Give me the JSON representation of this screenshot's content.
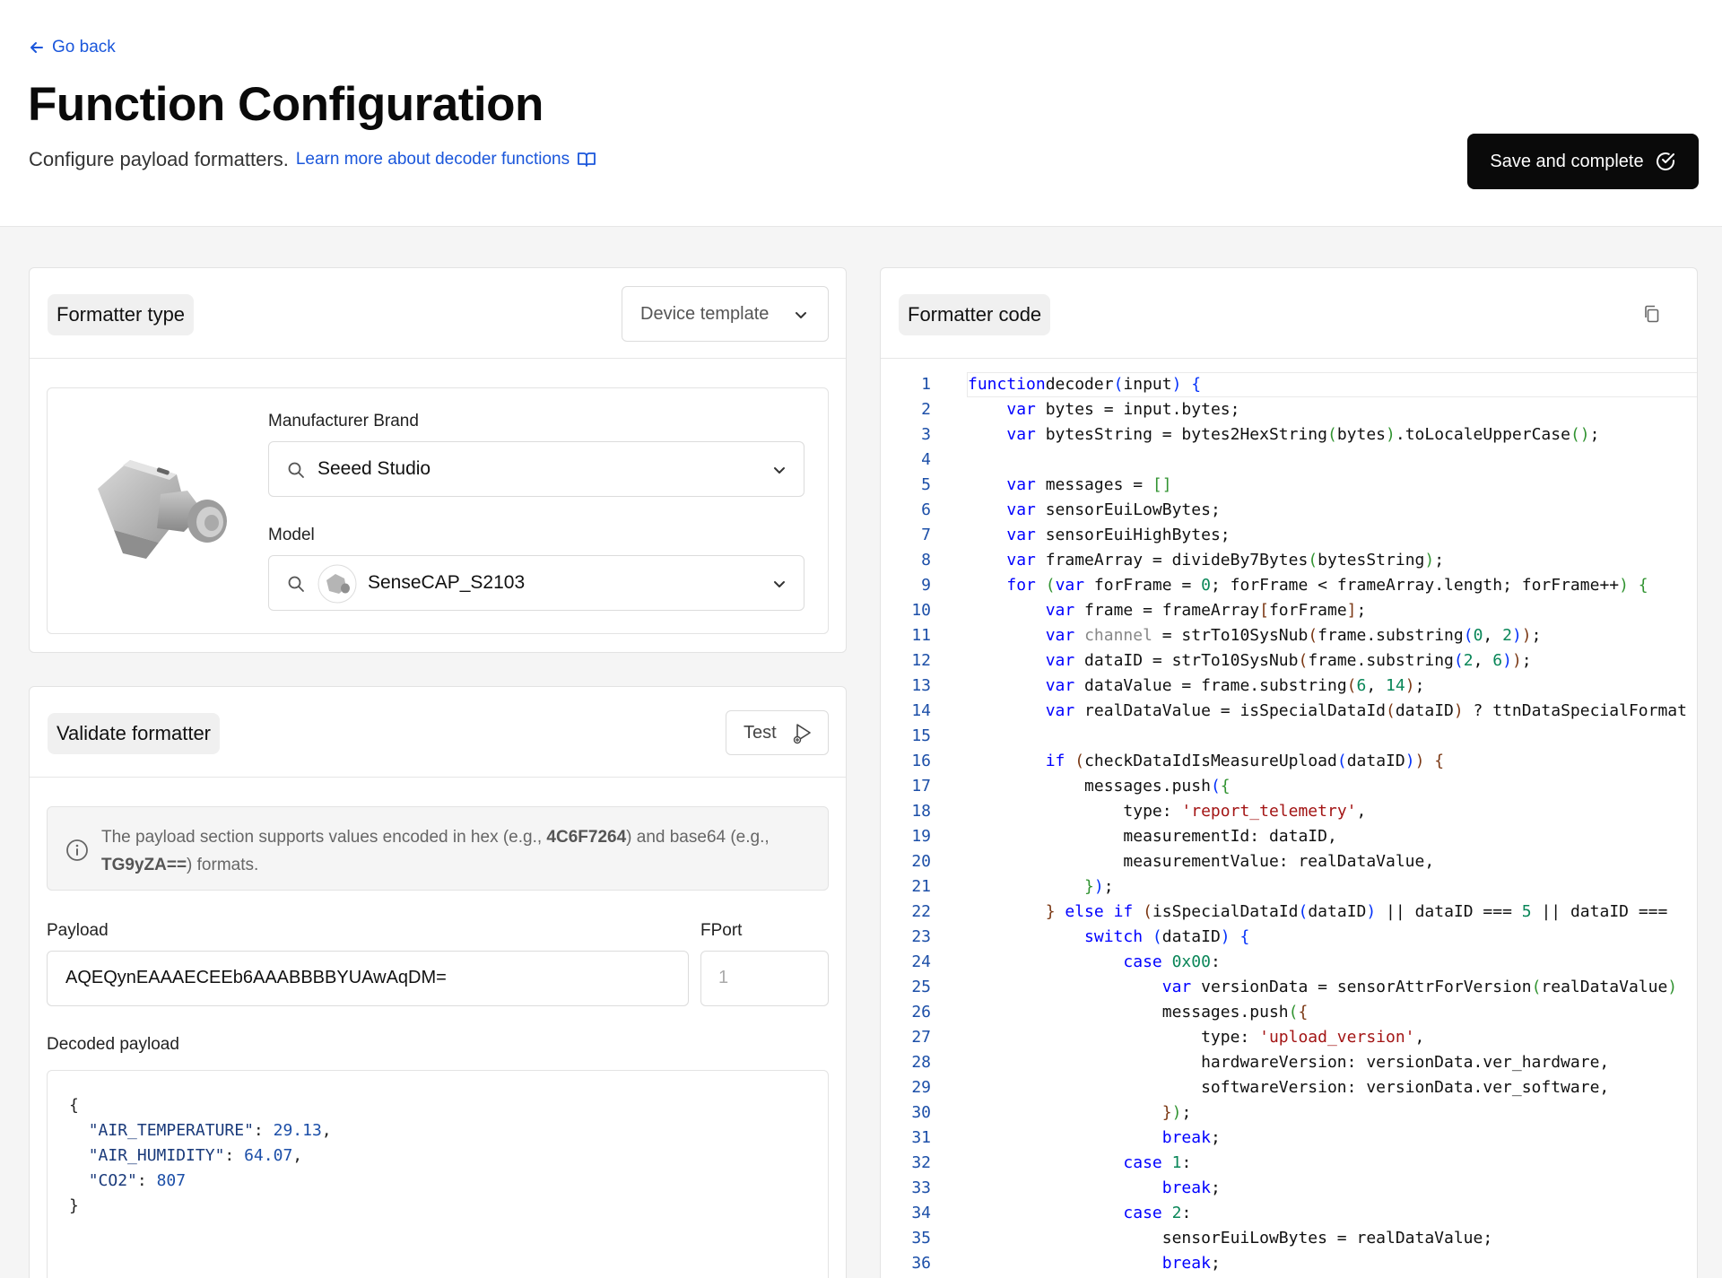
{
  "header": {
    "go_back": "Go back",
    "title": "Function Configuration",
    "subtitle": "Configure payload formatters.",
    "learn_more": "Learn more about decoder functions",
    "save_button": "Save and complete"
  },
  "formatter_type": {
    "heading": "Formatter type",
    "selected": "Device template",
    "manufacturer_label": "Manufacturer Brand",
    "manufacturer_value": "Seeed Studio",
    "model_label": "Model",
    "model_value": "SenseCAP_S2103"
  },
  "validate": {
    "heading": "Validate formatter",
    "test_button": "Test",
    "info": {
      "part1": "The payload section supports values encoded in hex (e.g., ",
      "hex_example": "4C6F7264",
      "part2": ") and base64 (e.g., ",
      "b64_example": "TG9yZA==",
      "part3": ") formats."
    },
    "payload_label": "Payload",
    "payload_value": "AQEQynEAAAECEEb6AAABBBBYUAwAqDM=",
    "fport_label": "FPort",
    "fport_placeholder": "1",
    "decoded_label": "Decoded payload",
    "decoded": {
      "open": "{",
      "close": "}",
      "entries": [
        {
          "key": "\"AIR_TEMPERATURE\"",
          "value": "29.13",
          "sep": ","
        },
        {
          "key": "\"AIR_HUMIDITY\"",
          "value": "64.07",
          "sep": ","
        },
        {
          "key": "\"CO2\"",
          "value": "807",
          "sep": ""
        }
      ]
    }
  },
  "code": {
    "heading": "Formatter code",
    "lines": [
      [
        [
          "kw",
          "function"
        ],
        [
          "",
          "decoder"
        ],
        [
          "br1",
          "("
        ],
        [
          "",
          "input"
        ],
        [
          "br1",
          ")"
        ],
        [
          "",
          ""
        ],
        [
          "br1",
          " {"
        ]
      ],
      [
        [
          "",
          "    "
        ],
        [
          "kw",
          "var"
        ],
        [
          "",
          " bytes = input.bytes;"
        ]
      ],
      [
        [
          "",
          "    "
        ],
        [
          "kw",
          "var"
        ],
        [
          "",
          " bytesString = bytes2HexString"
        ],
        [
          "br2",
          "("
        ],
        [
          "",
          "bytes"
        ],
        [
          "br2",
          ")"
        ],
        [
          "",
          ".toLocaleUpperCase"
        ],
        [
          "br2",
          "()"
        ],
        [
          "",
          ";"
        ]
      ],
      [
        [
          "",
          ""
        ]
      ],
      [
        [
          "",
          "    "
        ],
        [
          "kw",
          "var"
        ],
        [
          "",
          " messages = "
        ],
        [
          "br2",
          "[]"
        ]
      ],
      [
        [
          "",
          "    "
        ],
        [
          "kw",
          "var"
        ],
        [
          "",
          " sensorEuiLowBytes;"
        ]
      ],
      [
        [
          "",
          "    "
        ],
        [
          "kw",
          "var"
        ],
        [
          "",
          " sensorEuiHighBytes;"
        ]
      ],
      [
        [
          "",
          "    "
        ],
        [
          "kw",
          "var"
        ],
        [
          "",
          " frameArray = divideBy7Bytes"
        ],
        [
          "br2",
          "("
        ],
        [
          "",
          "bytesString"
        ],
        [
          "br2",
          ")"
        ],
        [
          "",
          ";"
        ]
      ],
      [
        [
          "",
          "    "
        ],
        [
          "kw",
          "for"
        ],
        [
          "",
          " "
        ],
        [
          "br2",
          "("
        ],
        [
          "kw",
          "var"
        ],
        [
          "",
          " forFrame = "
        ],
        [
          "num",
          "0"
        ],
        [
          "",
          "; forFrame < frameArray.length; forFrame++"
        ],
        [
          "br2",
          ")"
        ],
        [
          "br2",
          " {"
        ]
      ],
      [
        [
          "",
          "        "
        ],
        [
          "kw",
          "var"
        ],
        [
          "",
          " frame = frameArray"
        ],
        [
          "br3",
          "["
        ],
        [
          "",
          "forFrame"
        ],
        [
          "br3",
          "]"
        ],
        [
          "",
          ";"
        ]
      ],
      [
        [
          "",
          "        "
        ],
        [
          "kw",
          "var"
        ],
        [
          "",
          " "
        ],
        [
          "dim",
          "channel"
        ],
        [
          "",
          " = strTo10SysNub"
        ],
        [
          "br3",
          "("
        ],
        [
          "",
          "frame.substring"
        ],
        [
          "br1",
          "("
        ],
        [
          "num",
          "0"
        ],
        [
          "",
          ", "
        ],
        [
          "num",
          "2"
        ],
        [
          "br1",
          ")"
        ],
        [
          "br3",
          ")"
        ],
        [
          "",
          ";"
        ]
      ],
      [
        [
          "",
          "        "
        ],
        [
          "kw",
          "var"
        ],
        [
          "",
          " dataID = strTo10SysNub"
        ],
        [
          "br3",
          "("
        ],
        [
          "",
          "frame.substring"
        ],
        [
          "br1",
          "("
        ],
        [
          "num",
          "2"
        ],
        [
          "",
          ", "
        ],
        [
          "num",
          "6"
        ],
        [
          "br1",
          ")"
        ],
        [
          "br3",
          ")"
        ],
        [
          "",
          ";"
        ]
      ],
      [
        [
          "",
          "        "
        ],
        [
          "kw",
          "var"
        ],
        [
          "",
          " dataValue = frame.substring"
        ],
        [
          "br3",
          "("
        ],
        [
          "num",
          "6"
        ],
        [
          "",
          ", "
        ],
        [
          "num",
          "14"
        ],
        [
          "br3",
          ")"
        ],
        [
          "",
          ";"
        ]
      ],
      [
        [
          "",
          "        "
        ],
        [
          "kw",
          "var"
        ],
        [
          "",
          " realDataValue = isSpecialDataId"
        ],
        [
          "br3",
          "("
        ],
        [
          "",
          "dataID"
        ],
        [
          "br3",
          ")"
        ],
        [
          "",
          " ? ttnDataSpecialFormat"
        ]
      ],
      [
        [
          "",
          ""
        ]
      ],
      [
        [
          "",
          "        "
        ],
        [
          "kw",
          "if"
        ],
        [
          "",
          " "
        ],
        [
          "br3",
          "("
        ],
        [
          "",
          "checkDataIdIsMeasureUpload"
        ],
        [
          "br1",
          "("
        ],
        [
          "",
          "dataID"
        ],
        [
          "br1",
          ")"
        ],
        [
          "br3",
          ")"
        ],
        [
          "br3",
          " {"
        ]
      ],
      [
        [
          "",
          "            messages.push"
        ],
        [
          "br1",
          "("
        ],
        [
          "br2",
          "{"
        ]
      ],
      [
        [
          "",
          "                type: "
        ],
        [
          "str",
          "'report_telemetry'"
        ],
        [
          "",
          ","
        ]
      ],
      [
        [
          "",
          "                measurementId: dataID,"
        ]
      ],
      [
        [
          "",
          "                measurementValue: realDataValue,"
        ]
      ],
      [
        [
          "",
          "            "
        ],
        [
          "br2",
          "}"
        ],
        [
          "br1",
          ")"
        ],
        [
          "",
          ";"
        ]
      ],
      [
        [
          "",
          "        "
        ],
        [
          "br3",
          "}"
        ],
        [
          "kw",
          " else if"
        ],
        [
          "",
          " "
        ],
        [
          "br3",
          "("
        ],
        [
          "",
          "isSpecialDataId"
        ],
        [
          "br1",
          "("
        ],
        [
          "",
          "dataID"
        ],
        [
          "br1",
          ")"
        ],
        [
          "",
          " || dataID === "
        ],
        [
          "num",
          "5"
        ],
        [
          "",
          " || dataID === "
        ]
      ],
      [
        [
          "",
          "            "
        ],
        [
          "kw",
          "switch"
        ],
        [
          "",
          " "
        ],
        [
          "br1",
          "("
        ],
        [
          "",
          "dataID"
        ],
        [
          "br1",
          ")"
        ],
        [
          "br1",
          " {"
        ]
      ],
      [
        [
          "",
          "                "
        ],
        [
          "kw",
          "case"
        ],
        [
          "",
          " "
        ],
        [
          "num",
          "0x00"
        ],
        [
          "",
          ":"
        ]
      ],
      [
        [
          "",
          "                    "
        ],
        [
          "kw",
          "var"
        ],
        [
          "",
          " versionData = sensorAttrForVersion"
        ],
        [
          "br2",
          "("
        ],
        [
          "",
          "realDataValue"
        ],
        [
          "br2",
          ")"
        ]
      ],
      [
        [
          "",
          "                    messages.push"
        ],
        [
          "br2",
          "("
        ],
        [
          "br3",
          "{"
        ]
      ],
      [
        [
          "",
          "                        type: "
        ],
        [
          "str",
          "'upload_version'"
        ],
        [
          "",
          ","
        ]
      ],
      [
        [
          "",
          "                        hardwareVersion: versionData.ver_hardware,"
        ]
      ],
      [
        [
          "",
          "                        softwareVersion: versionData.ver_software,"
        ]
      ],
      [
        [
          "",
          "                    "
        ],
        [
          "br3",
          "}"
        ],
        [
          "br2",
          ")"
        ],
        [
          "",
          ";"
        ]
      ],
      [
        [
          "",
          "                    "
        ],
        [
          "kw",
          "break"
        ],
        [
          "",
          ";"
        ]
      ],
      [
        [
          "",
          "                "
        ],
        [
          "kw",
          "case"
        ],
        [
          "",
          " "
        ],
        [
          "num",
          "1"
        ],
        [
          "",
          ":"
        ]
      ],
      [
        [
          "",
          "                    "
        ],
        [
          "kw",
          "break"
        ],
        [
          "",
          ";"
        ]
      ],
      [
        [
          "",
          "                "
        ],
        [
          "kw",
          "case"
        ],
        [
          "",
          " "
        ],
        [
          "num",
          "2"
        ],
        [
          "",
          ":"
        ]
      ],
      [
        [
          "",
          "                    sensorEuiLowBytes = realDataValue;"
        ]
      ],
      [
        [
          "",
          "                    "
        ],
        [
          "kw",
          "break"
        ],
        [
          "",
          ";"
        ]
      ]
    ]
  },
  "icons": {
    "back": "arrow-left-icon",
    "book": "book-open-icon",
    "save": "check-circle-icon",
    "chevron": "chevron-down-icon",
    "search": "search-icon",
    "copy": "copy-icon",
    "test": "play-icon",
    "info": "info-circle-icon"
  },
  "colors": {
    "accent": "#1a56db",
    "primary_button": "#0a0a0a",
    "keyword": "#0000ff",
    "string": "#a31515",
    "number": "#098658"
  }
}
